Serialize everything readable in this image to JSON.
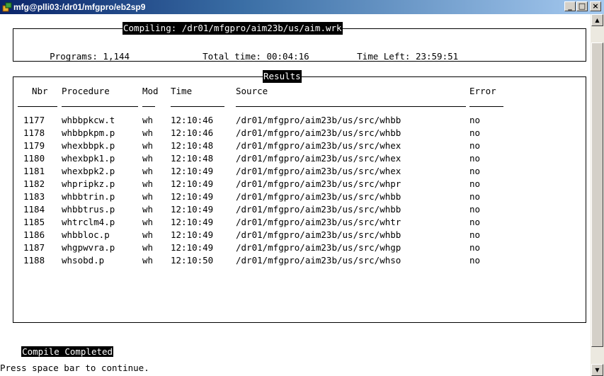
{
  "window": {
    "title": "mfg@plli03:/dr01/mfgpro/eb2sp9",
    "minimize": "_",
    "maximize": "□",
    "close": "×"
  },
  "compile": {
    "title": "Compiling: /dr01/mfgpro/aim23b/us/aim.wrk",
    "programs_label": "Programs:",
    "programs_value": "1,144",
    "total_time_label": "Total time:",
    "total_time_value": "00:04:16",
    "time_left_label": "Time Left:",
    "time_left_value": "23:59:51"
  },
  "results": {
    "title": "Results",
    "headers": {
      "nbr": "Nbr",
      "procedure": "Procedure",
      "mod": "Mod",
      "time": "Time",
      "source": "Source",
      "error": "Error"
    },
    "rows": [
      {
        "nbr": "1177",
        "procedure": "whbbpkcw.t",
        "mod": "wh",
        "time": "12:10:46",
        "source": "/dr01/mfgpro/aim23b/us/src/whbb",
        "error": "no"
      },
      {
        "nbr": "1178",
        "procedure": "whbbpkpm.p",
        "mod": "wh",
        "time": "12:10:46",
        "source": "/dr01/mfgpro/aim23b/us/src/whbb",
        "error": "no"
      },
      {
        "nbr": "1179",
        "procedure": "whexbbpk.p",
        "mod": "wh",
        "time": "12:10:48",
        "source": "/dr01/mfgpro/aim23b/us/src/whex",
        "error": "no"
      },
      {
        "nbr": "1180",
        "procedure": "whexbpk1.p",
        "mod": "wh",
        "time": "12:10:48",
        "source": "/dr01/mfgpro/aim23b/us/src/whex",
        "error": "no"
      },
      {
        "nbr": "1181",
        "procedure": "whexbpk2.p",
        "mod": "wh",
        "time": "12:10:49",
        "source": "/dr01/mfgpro/aim23b/us/src/whex",
        "error": "no"
      },
      {
        "nbr": "1182",
        "procedure": "whpripkz.p",
        "mod": "wh",
        "time": "12:10:49",
        "source": "/dr01/mfgpro/aim23b/us/src/whpr",
        "error": "no"
      },
      {
        "nbr": "1183",
        "procedure": "whbbtrin.p",
        "mod": "wh",
        "time": "12:10:49",
        "source": "/dr01/mfgpro/aim23b/us/src/whbb",
        "error": "no"
      },
      {
        "nbr": "1184",
        "procedure": "whbbtrus.p",
        "mod": "wh",
        "time": "12:10:49",
        "source": "/dr01/mfgpro/aim23b/us/src/whbb",
        "error": "no"
      },
      {
        "nbr": "1185",
        "procedure": "whtrclm4.p",
        "mod": "wh",
        "time": "12:10:49",
        "source": "/dr01/mfgpro/aim23b/us/src/whtr",
        "error": "no"
      },
      {
        "nbr": "1186",
        "procedure": "whbbloc.p",
        "mod": "wh",
        "time": "12:10:49",
        "source": "/dr01/mfgpro/aim23b/us/src/whbb",
        "error": "no"
      },
      {
        "nbr": "1187",
        "procedure": "whgpwvra.p",
        "mod": "wh",
        "time": "12:10:49",
        "source": "/dr01/mfgpro/aim23b/us/src/whgp",
        "error": "no"
      },
      {
        "nbr": "1188",
        "procedure": "whsobd.p",
        "mod": "wh",
        "time": "12:10:50",
        "source": "/dr01/mfgpro/aim23b/us/src/whso",
        "error": "no"
      }
    ]
  },
  "status": {
    "completed": "Compile Completed",
    "prompt": "Press space bar to continue."
  }
}
